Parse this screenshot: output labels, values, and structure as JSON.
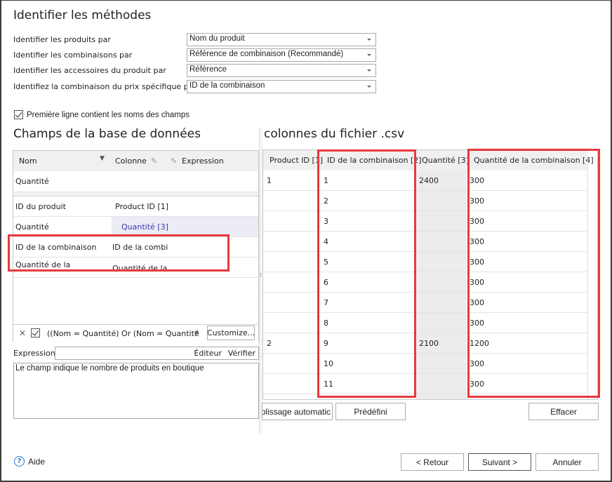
{
  "section_identify": {
    "title": "Identifier les méthodes",
    "rows": [
      {
        "label": "Identifier les produits par",
        "value": "Nom du produit"
      },
      {
        "label": "Identifier les combinaisons par",
        "value": "Référence de combinaison (Recommandé)"
      },
      {
        "label": "Identifier les accessoires du produit par",
        "value": "Référence"
      },
      {
        "label": "Identifiez la combinaison du prix spécifique par",
        "value": "ID de la combinaison"
      }
    ]
  },
  "first_line_checkbox": {
    "label": "Première ligne contient les noms des champs",
    "checked": true
  },
  "db_fields": {
    "title": "Champs de la base de données",
    "headers": {
      "name": "Nom",
      "column": "Colonne",
      "expression": "Expression"
    },
    "filter_row_value": "Quantité",
    "rows": [
      {
        "name": "ID du produit",
        "column": "Product ID [1]"
      },
      {
        "name": "Quantité",
        "column": "Quantité [3]"
      },
      {
        "name": "ID de la combinaison",
        "column": "ID de la combi"
      },
      {
        "name": "Quantité de la",
        "column": "Quantité de la"
      }
    ],
    "filter_text": "((Nom = Quantité) Or (Nom = Quantité",
    "customize_label": "Customize...",
    "expression_label": "Expression",
    "editor_label": "Éditeur",
    "verify_label": "Vérifier",
    "description": "Le champ indique le nombre de produits en boutique"
  },
  "csv_columns": {
    "title": "colonnes du fichier .csv",
    "headers": [
      "Product ID [1]",
      "ID de la combinaison [2]",
      "Quantité [3]",
      "Quantité de la combinaison [4]"
    ],
    "rows": [
      [
        "1",
        "1",
        "2400",
        "300"
      ],
      [
        "",
        "2",
        "",
        "300"
      ],
      [
        "",
        "3",
        "",
        "300"
      ],
      [
        "",
        "4",
        "",
        "300"
      ],
      [
        "",
        "5",
        "",
        "300"
      ],
      [
        "",
        "6",
        "",
        "300"
      ],
      [
        "",
        "7",
        "",
        "300"
      ],
      [
        "",
        "8",
        "",
        "300"
      ],
      [
        "2",
        "9",
        "2100",
        "1200"
      ],
      [
        "",
        "10",
        "",
        "300"
      ],
      [
        "",
        "11",
        "",
        "300"
      ]
    ],
    "autofill_label": "nplissage automatic",
    "predefined_label": "Prédéfini",
    "clear_label": "Effacer"
  },
  "footer": {
    "help_label": "Aide",
    "back_label": "< Retour",
    "next_label": "Suivant >",
    "cancel_label": "Annuler"
  },
  "colors": {
    "highlight": "#e8393e",
    "link": "#3a3ab0",
    "help": "#2a7ad5"
  }
}
